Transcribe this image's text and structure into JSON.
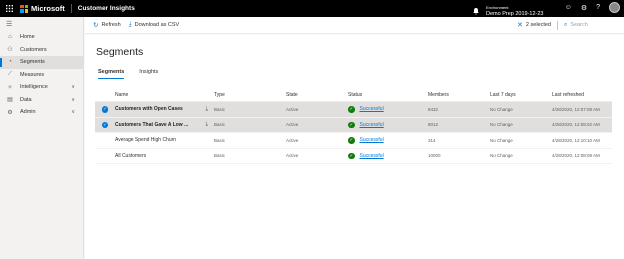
{
  "app": {
    "brand": "Microsoft",
    "title": "Customer Insights",
    "environment_label": "Environment",
    "environment_name": "Demo Prep 2019-12-23"
  },
  "sidebar": {
    "items": [
      {
        "label": "Home",
        "icon": "home-icon",
        "active": false,
        "expandable": false
      },
      {
        "label": "Customers",
        "icon": "customers-icon",
        "active": false,
        "expandable": false
      },
      {
        "label": "Segments",
        "icon": "segments-icon",
        "active": true,
        "expandable": false
      },
      {
        "label": "Measures",
        "icon": "measures-icon",
        "active": false,
        "expandable": false
      },
      {
        "label": "Intelligence",
        "icon": "intelligence-icon",
        "active": false,
        "expandable": true
      },
      {
        "label": "Data",
        "icon": "data-icon",
        "active": false,
        "expandable": true
      },
      {
        "label": "Admin",
        "icon": "admin-icon",
        "active": false,
        "expandable": true
      }
    ]
  },
  "toolbar": {
    "refresh_label": "Refresh",
    "download_label": "Download as CSV",
    "selected_label": "2 selected",
    "search_placeholder": "Search"
  },
  "page": {
    "title": "Segments",
    "tabs": [
      {
        "label": "Segments",
        "active": true
      },
      {
        "label": "Insights",
        "active": false
      }
    ]
  },
  "table": {
    "headers": {
      "name": "Name",
      "type": "Type",
      "state": "State",
      "status": "Status",
      "members": "Members",
      "last7": "Last 7 days",
      "last_refreshed": "Last refreshed"
    },
    "rows": [
      {
        "selected": true,
        "name": "Customers with Open Cases",
        "type": "Basic",
        "state": "Active",
        "status": "Successful",
        "members": "8432",
        "last7": "No Change",
        "refreshed": "4/28/2020, 12:07:08 AM"
      },
      {
        "selected": true,
        "name": "Customers That Gave A Low ...",
        "type": "Basic",
        "state": "Active",
        "status": "Successful",
        "members": "8012",
        "last7": "No Change",
        "refreshed": "4/28/2020, 12:08:02 AM"
      },
      {
        "selected": false,
        "name": "Average Spend High Churn",
        "type": "Basic",
        "state": "Active",
        "status": "Successful",
        "members": "314",
        "last7": "No Change",
        "refreshed": "4/28/2020, 12:10:10 AM"
      },
      {
        "selected": false,
        "name": "All Customers",
        "type": "Basic",
        "state": "Active",
        "status": "Successful",
        "members": "10000",
        "last7": "No Change",
        "refreshed": "4/28/2020, 12:08:08 AM"
      }
    ]
  },
  "colors": {
    "accent": "#0078d4",
    "success": "#107c10",
    "topbar": "#000000"
  }
}
